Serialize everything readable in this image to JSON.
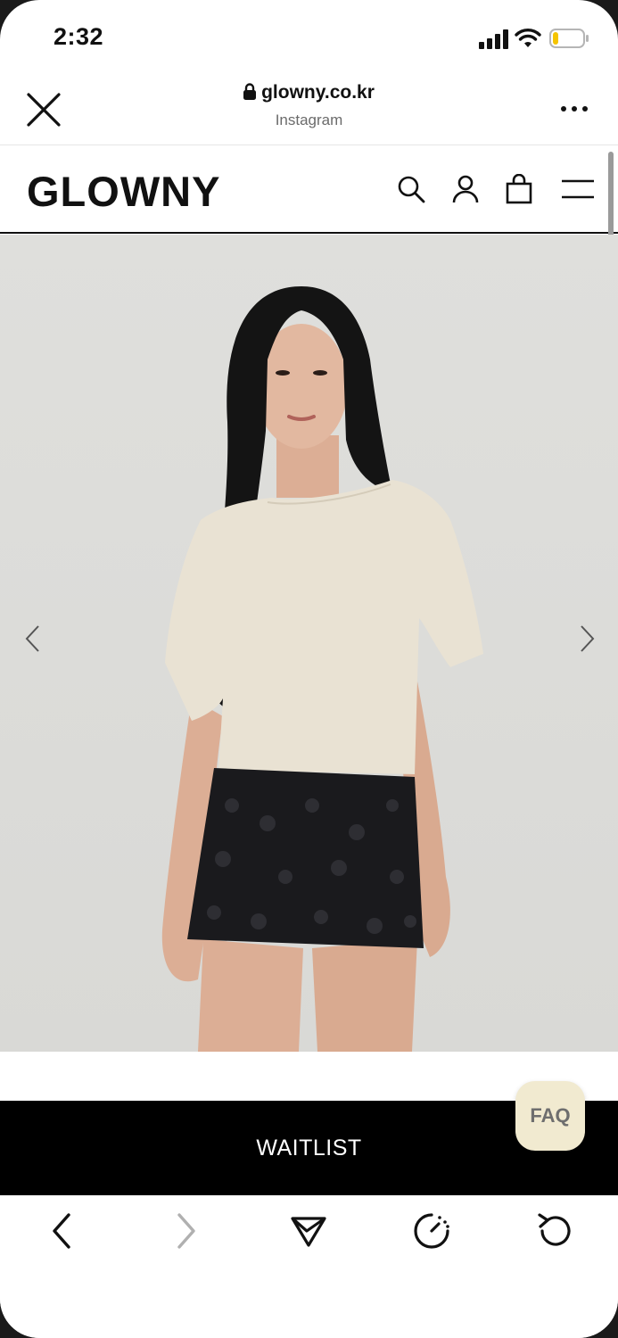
{
  "status_bar": {
    "time": "2:32"
  },
  "browser": {
    "domain": "glowny.co.kr",
    "source": "Instagram"
  },
  "site": {
    "logo": "GLOWNY"
  },
  "hero": {
    "image_alt": "Model wearing beige draped short-sleeve top and black sequin mini skirt"
  },
  "cta": {
    "label": "WAITLIST"
  },
  "faq": {
    "label": "FAQ"
  },
  "colors": {
    "accent": "#000000",
    "faq_bg": "#f1ead0",
    "battery_level": "#f5c400"
  },
  "battery": {
    "level": 0.12
  }
}
